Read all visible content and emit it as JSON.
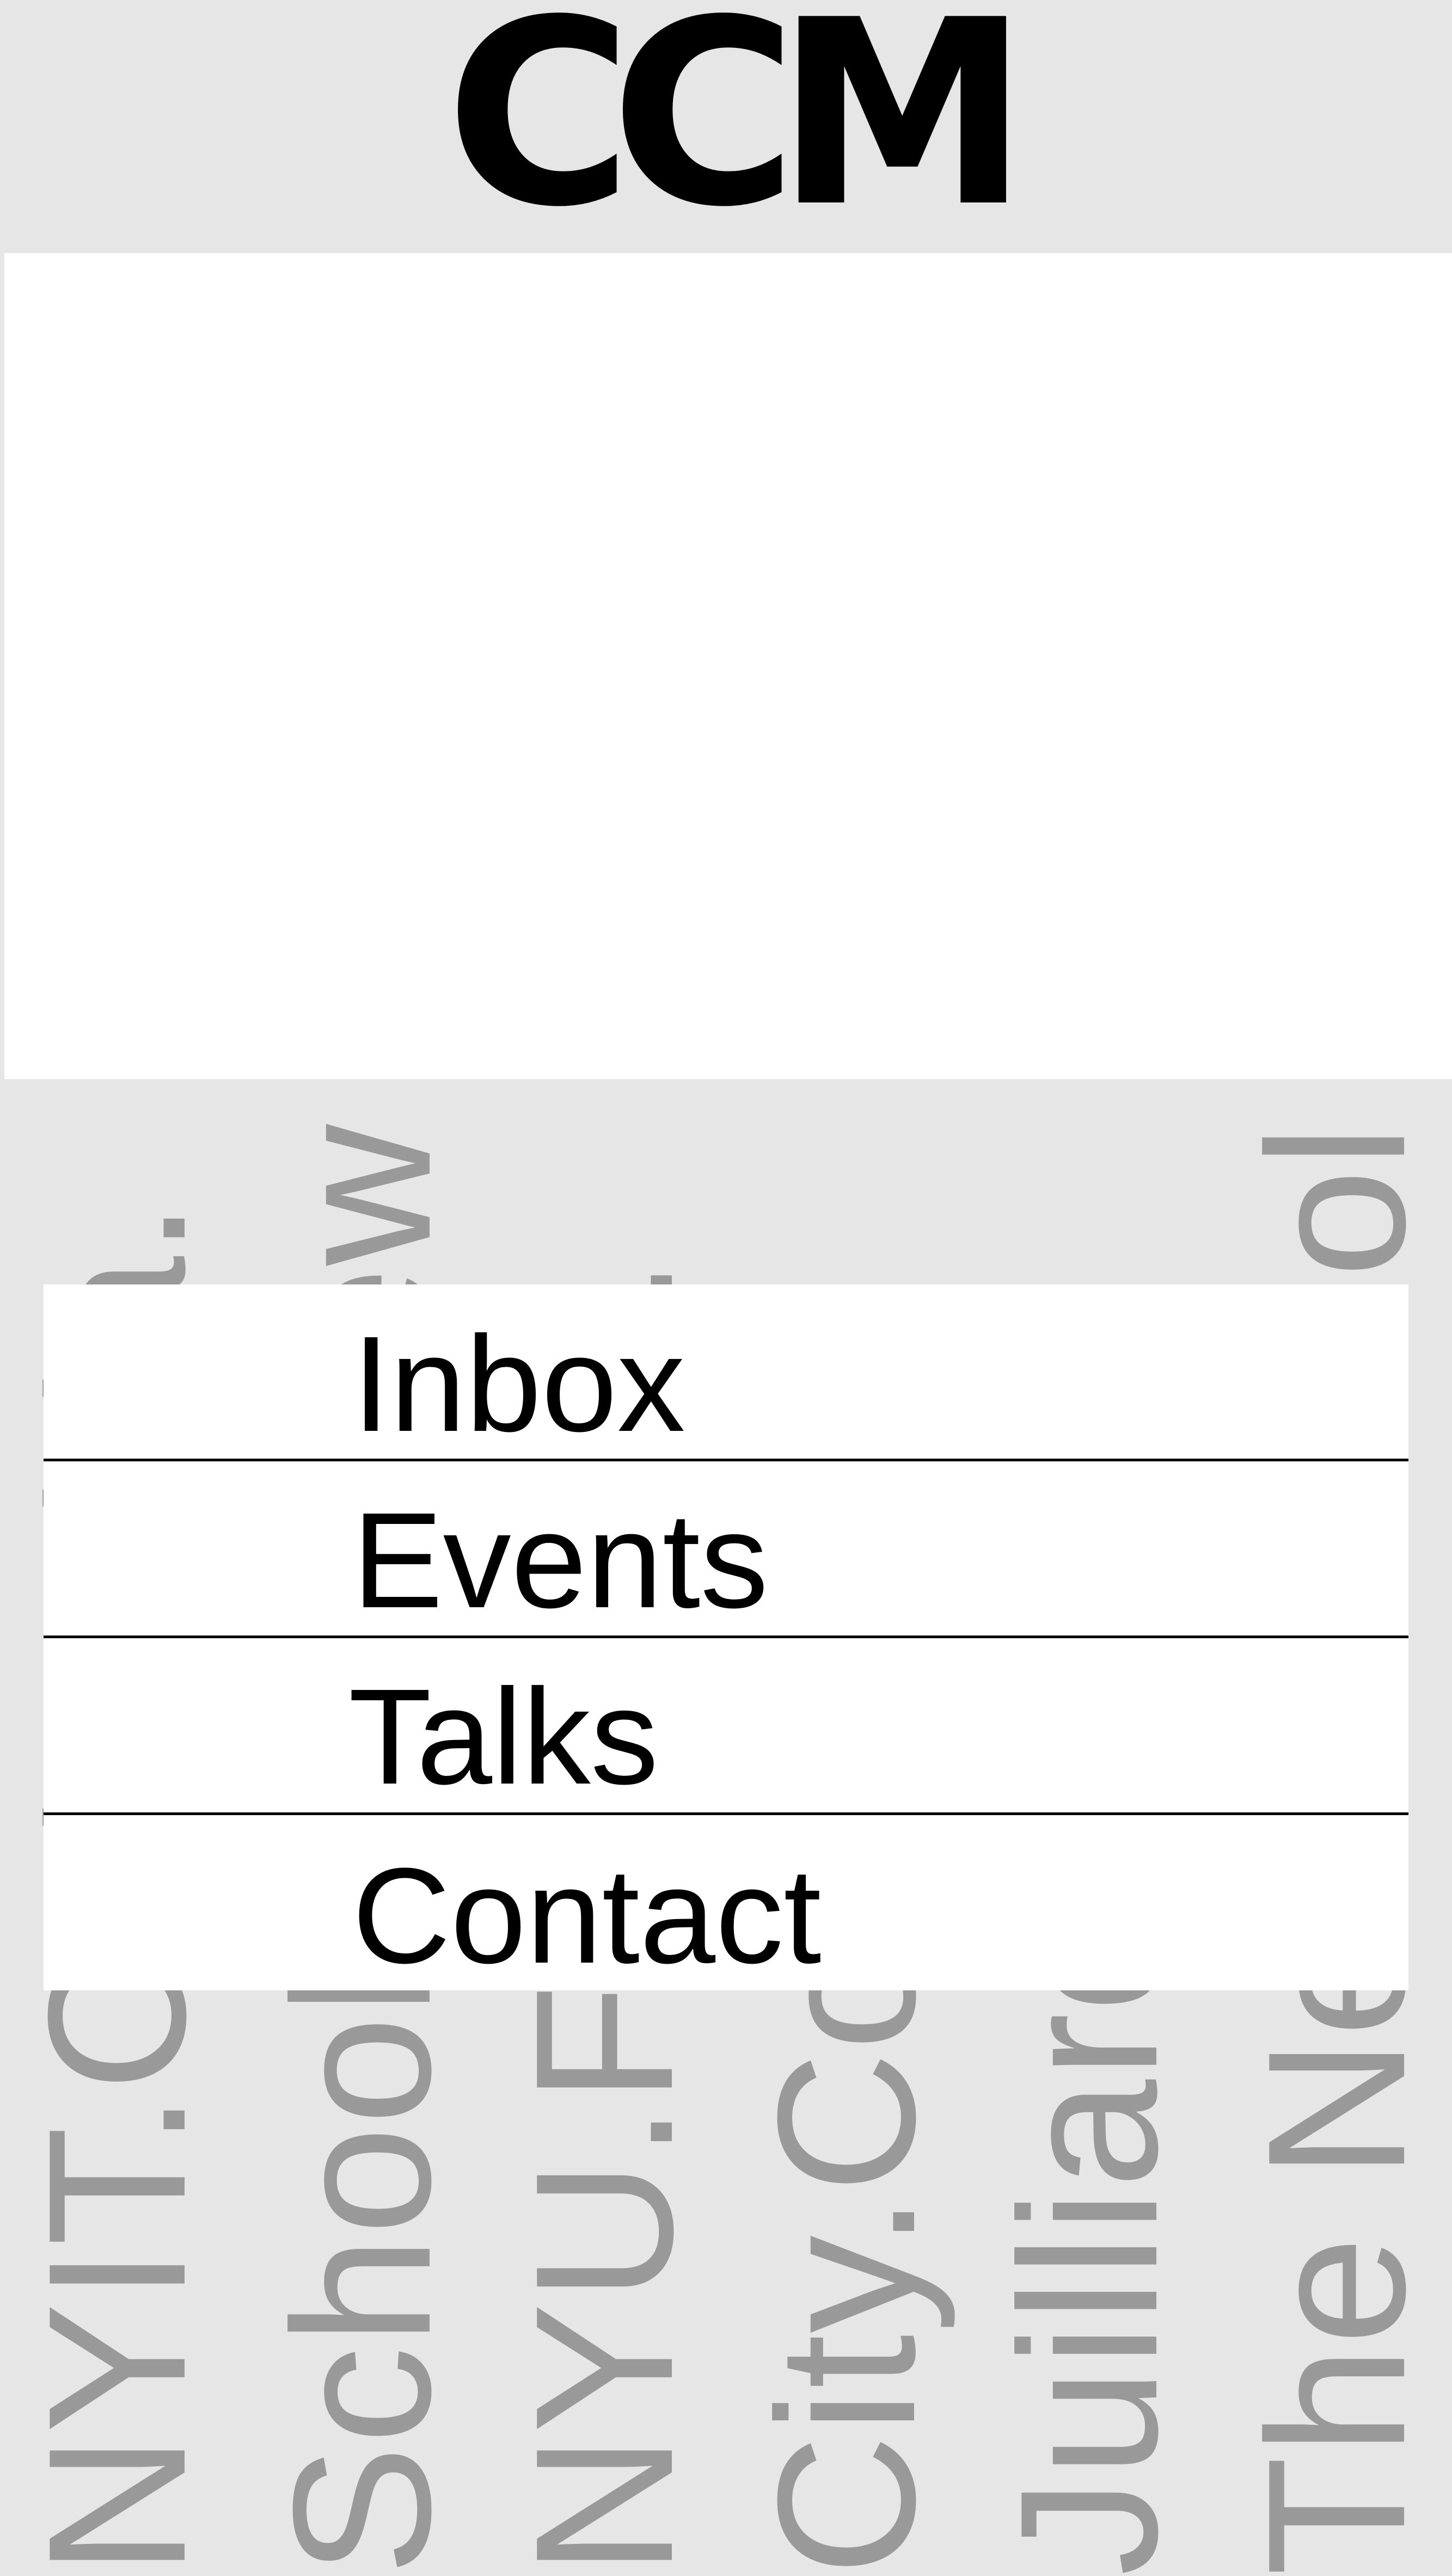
{
  "app": {
    "logo_text": "CCM"
  },
  "background_wall": {
    "text_color": "#999999",
    "words": [
      "NYIT.Columbia.",
      "School.The New",
      "NYU.Fordham.",
      "City.College of",
      "Juilliard.The",
      "The New School"
    ]
  },
  "menu": {
    "items": [
      {
        "label": "Inbox"
      },
      {
        "label": "Events"
      },
      {
        "label": "Talks"
      },
      {
        "label": "Contact"
      }
    ]
  },
  "colors": {
    "background": "#e6e6e6",
    "panel": "#ffffff",
    "text": "#000000",
    "wall_text": "#999999"
  }
}
